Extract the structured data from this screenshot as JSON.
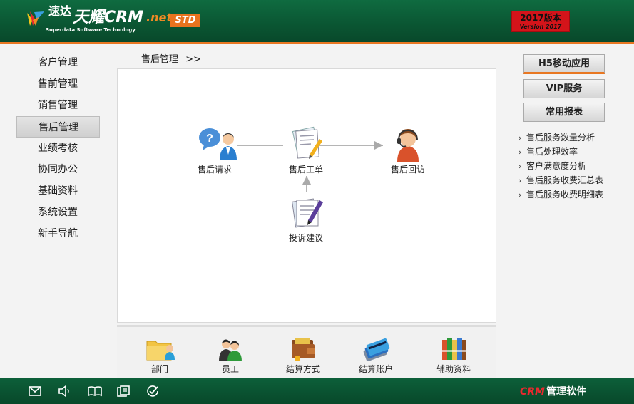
{
  "header": {
    "logo_cn": "速达",
    "logo_main": "天耀CRM",
    "logo_net": ".net",
    "logo_sub": "Superdata Software Technology",
    "edition": "STD",
    "version_cn": "2017版本",
    "version_en": "Version 2017"
  },
  "nav": {
    "items": [
      {
        "label": "客户管理"
      },
      {
        "label": "售前管理"
      },
      {
        "label": "销售管理"
      },
      {
        "label": "售后管理"
      },
      {
        "label": "业绩考核"
      },
      {
        "label": "协同办公"
      },
      {
        "label": "基础资料"
      },
      {
        "label": "系统设置"
      },
      {
        "label": "新手导航"
      }
    ],
    "active": "售后管理"
  },
  "breadcrumb": {
    "text": "售后管理",
    "separator": ">>"
  },
  "flow": {
    "request": "售后请求",
    "workorder": "售后工单",
    "visit": "售后回访",
    "complaint": "投诉建议"
  },
  "bottom": {
    "items": [
      {
        "label": "部门"
      },
      {
        "label": "员工"
      },
      {
        "label": "结算方式"
      },
      {
        "label": "结算账户"
      },
      {
        "label": "辅助资料"
      }
    ]
  },
  "right": {
    "h5": "H5移动应用",
    "vip": "VIP服务",
    "reports_btn": "常用报表",
    "reports": [
      {
        "label": "售后服务数量分析"
      },
      {
        "label": "售后处理效率"
      },
      {
        "label": "客户满意度分析"
      },
      {
        "label": "售后服务收费汇总表"
      },
      {
        "label": "售后服务收费明细表"
      }
    ]
  },
  "footer": {
    "brand_crm": "CRM",
    "brand_text": "管理软件"
  },
  "colors": {
    "header_green": "#0a5532",
    "accent_orange": "#e87722",
    "version_red": "#d4141a"
  }
}
